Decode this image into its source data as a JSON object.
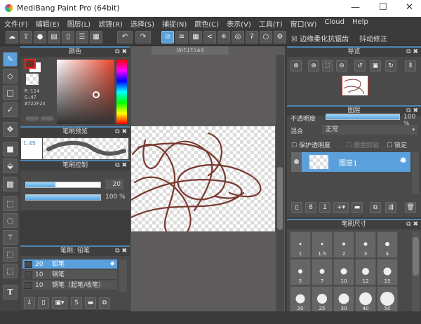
{
  "window": {
    "title": "MediBang Paint Pro (64bit)",
    "minimize": "—",
    "maximize": "☐",
    "close": "✕"
  },
  "menu": [
    "文件(F)",
    "编辑(E)",
    "图层(L)",
    "滤镜(R)",
    "选择(S)",
    "捕捉(N)",
    "颜色(C)",
    "表示(V)",
    "工具(T)",
    "窗口(W)",
    "Cloud",
    "Help"
  ],
  "toolbar": {
    "antialias_label": "边缘柔化抗锯齿",
    "stabilizer_label": "抖动修正"
  },
  "color_panel": {
    "title": "颜色",
    "r": "R:114",
    "g": "G:47",
    "hex": "#722F23",
    "foreground": "#722f23",
    "background": "#ffffff"
  },
  "brush_preview": {
    "title": "笔刷预览",
    "size": "1.45"
  },
  "brush_control": {
    "title": "笔刷控制",
    "size_value": "20",
    "size_fraction": 0.4,
    "opacity_value": "100 %",
    "opacity_fraction": 1.0
  },
  "canvas": {
    "tab": "Untitled",
    "stroke_color": "#7a3a30"
  },
  "brush_list": {
    "title": "笔刷: 铅笔",
    "items": [
      {
        "size": "20",
        "name": "铅笔",
        "selected": true
      },
      {
        "size": "10",
        "name": "钢笔"
      },
      {
        "size": "10",
        "name": "钢笔（起笔/收笔）"
      }
    ]
  },
  "navigator": {
    "title": "导览"
  },
  "layers": {
    "title": "图层",
    "opacity_label": "不透明度",
    "opacity_value": "100 %",
    "opacity_fraction": 1.0,
    "blend_label": "混合",
    "blend_value": "正常",
    "protect_alpha": "保护透明度",
    "clipping": "图层剪贴",
    "lock": "锁定",
    "items": [
      {
        "name": "图层1",
        "selected": true
      }
    ]
  },
  "brush_size": {
    "title": "笔刷尺寸",
    "sizes": [
      "1",
      "1.5",
      "2",
      "3",
      "4",
      "5",
      "7",
      "10",
      "12",
      "15",
      "20",
      "25",
      "30",
      "40",
      "50"
    ]
  }
}
